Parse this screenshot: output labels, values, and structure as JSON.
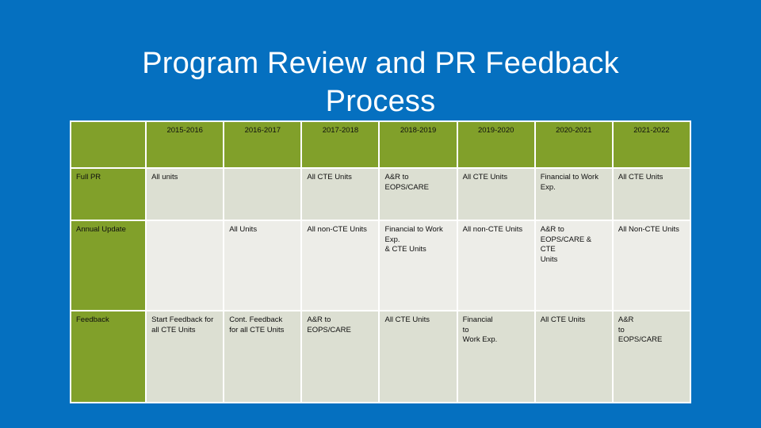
{
  "slide": {
    "title": "Program Review and PR Feedback\nProcess",
    "background_color": "#0570c0",
    "header_color": "#81a02a",
    "cell_color_a": "#dcdfd2",
    "cell_color_b": "#ededE8"
  },
  "table": {
    "corner_label": "",
    "columns": [
      "2015-2016",
      "2016-2017",
      "2017-2018",
      "2018-2019",
      "2019-2020",
      "2020-2021",
      "2021-2022"
    ],
    "rows": [
      {
        "label": "Full PR",
        "cells": [
          "All units",
          "",
          "All CTE Units",
          "A&R to\nEOPS/CARE",
          "All CTE Units",
          "Financial to Work\nExp.",
          "All CTE Units"
        ]
      },
      {
        "label": "Annual Update",
        "cells": [
          "",
          "All Units",
          "All non-CTE Units",
          "Financial to Work\nExp.\n& CTE Units",
          "All non-CTE Units",
          "A&R to\nEOPS/CARE & CTE\nUnits",
          "All Non-CTE Units"
        ]
      },
      {
        "label": "Feedback",
        "cells": [
          "Start Feedback for\nall CTE Units",
          "Cont. Feedback\nfor all CTE Units",
          "A&R to\nEOPS/CARE",
          "All CTE Units",
          "Financial\nto\nWork Exp.",
          "All CTE Units",
          "A&R\nto\nEOPS/CARE"
        ]
      }
    ]
  }
}
